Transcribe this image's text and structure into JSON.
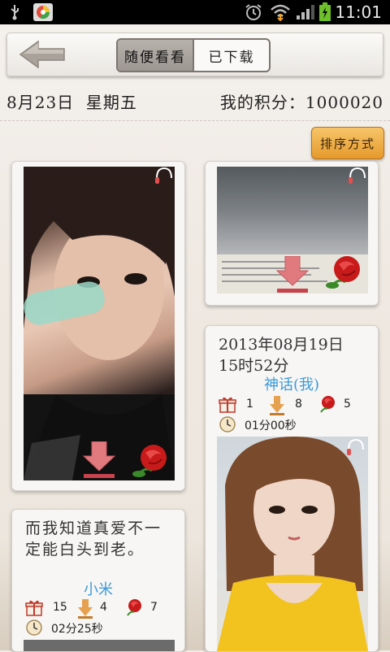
{
  "status_bar": {
    "time": "11:01",
    "icons": [
      "usb-icon",
      "app-icon",
      "alarm-icon",
      "wifi-icon",
      "signal-icon",
      "battery-icon"
    ]
  },
  "toolbar": {
    "back_icon": "back-arrow-icon",
    "tabs": [
      {
        "label": "随便看看",
        "active": true
      },
      {
        "label": "已下载",
        "active": false
      }
    ]
  },
  "info": {
    "date": "8月23日  星期五",
    "points_label": "我的积分：",
    "points_value": "1000020"
  },
  "sort_button": "排序方式",
  "cards": [
    {
      "title": "2013年08月19日\n15时52分",
      "author": "神话(我)",
      "gifts": "1",
      "downloads": "8",
      "roses": "5",
      "duration": "01分00秒"
    },
    {
      "title": "而我知道真爱不一定能白头到老。",
      "author": "小米",
      "gifts": "15",
      "downloads": "4",
      "roses": "7",
      "duration": "02分25秒"
    }
  ],
  "colors": {
    "accent": "#e59a2c",
    "author": "#3d9ad9",
    "status_bg": "#000000"
  }
}
